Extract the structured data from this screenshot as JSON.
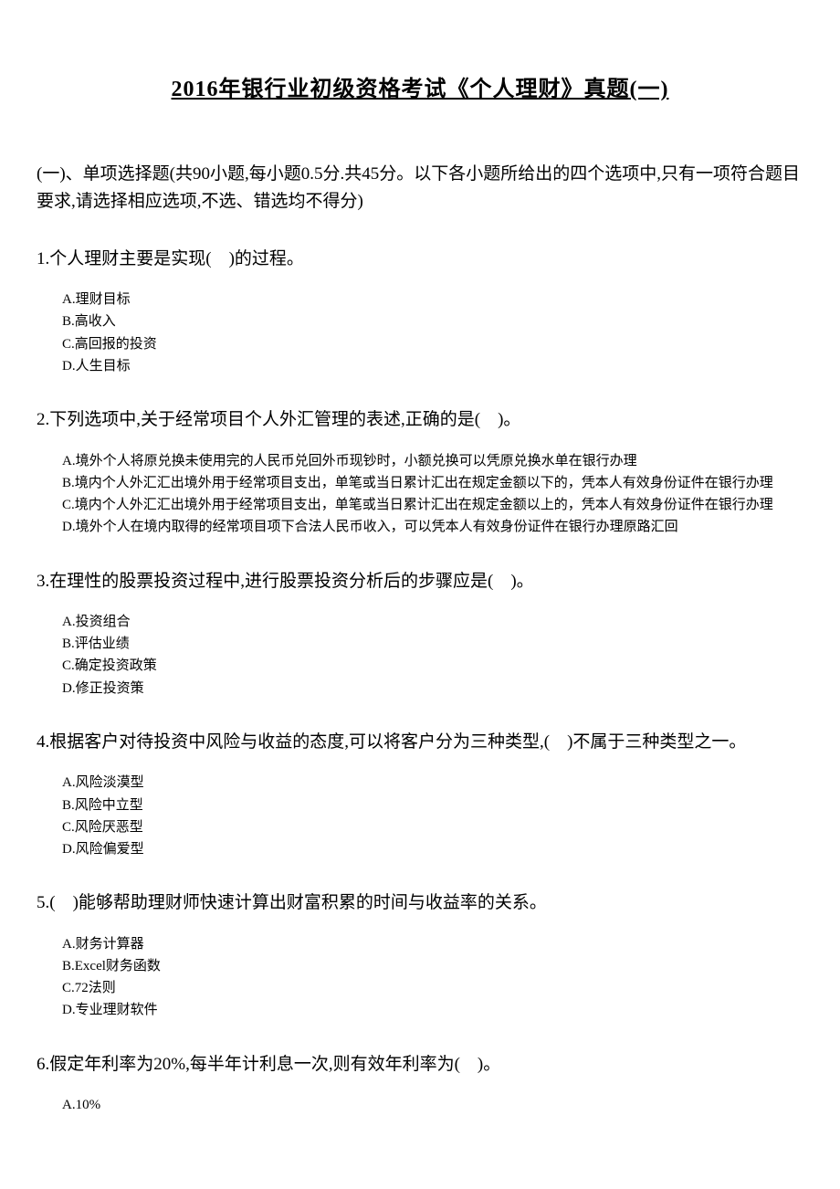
{
  "title": "2016年银行业初级资格考试《个人理财》真题(一)",
  "section_header": "(一)、单项选择题(共90小题,每小题0.5分.共45分。以下各小题所给出的四个选项中,只有一项符合题目要求,请选择相应选项,不选、错选均不得分)",
  "questions": [
    {
      "text": "1.个人理财主要是实现(　)的过程。",
      "options": [
        "A.理财目标",
        "B.高收入",
        "C.高回报的投资",
        "D.人生目标"
      ]
    },
    {
      "text": "2.下列选项中,关于经常项目个人外汇管理的表述,正确的是(　)。",
      "options": [
        "A.境外个人将原兑换未使用完的人民币兑回外币现钞时，小额兑换可以凭原兑换水单在银行办理",
        "B.境内个人外汇汇出境外用于经常项目支出，单笔或当日累计汇出在规定金额以下的，凭本人有效身份证件在银行办理",
        "C.境内个人外汇汇出境外用于经常项目支出，单笔或当日累计汇出在规定金额以上的，凭本人有效身份证件在银行办理",
        "D.境外个人在境内取得的经常项目项下合法人民币收入，可以凭本人有效身份证件在银行办理原路汇回"
      ]
    },
    {
      "text": "3.在理性的股票投资过程中,进行股票投资分析后的步骤应是(　)。",
      "options": [
        "A.投资组合",
        "B.评估业绩",
        "C.确定投资政策",
        "D.修正投资策"
      ]
    },
    {
      "text": "4.根据客户对待投资中风险与收益的态度,可以将客户分为三种类型,(　)不属于三种类型之一。",
      "options": [
        "A.风险淡漠型",
        "B.风险中立型",
        "C.风险厌恶型",
        "D.风险偏爱型"
      ]
    },
    {
      "text": "5.(　)能够帮助理财师快速计算出财富积累的时间与收益率的关系。",
      "options": [
        "A.财务计算器",
        "B.Excel财务函数",
        "C.72法则",
        "D.专业理财软件"
      ]
    },
    {
      "text": "6.假定年利率为20%,每半年计利息一次,则有效年利率为(　)。",
      "options": [
        "A.10%"
      ]
    }
  ]
}
